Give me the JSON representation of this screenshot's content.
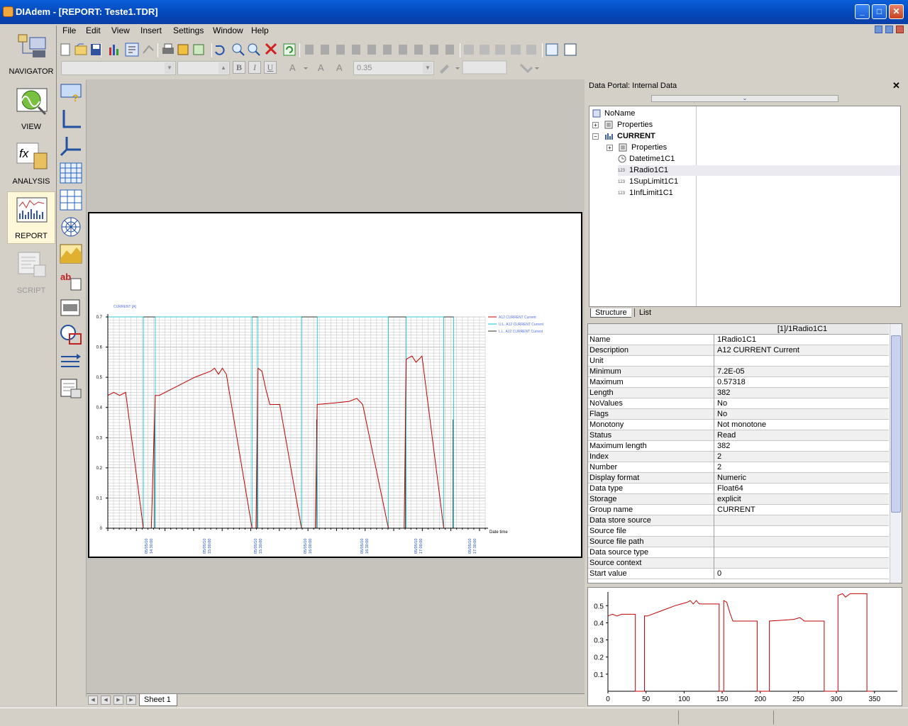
{
  "window": {
    "title": "DIAdem - [REPORT:   Teste1.TDR]",
    "minimize": "_",
    "maximize": "□",
    "close": "✕"
  },
  "menu": [
    "File",
    "Edit",
    "View",
    "Insert",
    "Settings",
    "Window",
    "Help"
  ],
  "format_bar": {
    "line_width": "0.35",
    "bold": "B",
    "italic": "I",
    "underline": "U"
  },
  "nav": {
    "items": [
      {
        "label": "NAVIGATOR",
        "icon": "navigator-icon",
        "state": "normal"
      },
      {
        "label": "VIEW",
        "icon": "view-icon",
        "state": "normal"
      },
      {
        "label": "ANALYSIS",
        "icon": "analysis-icon",
        "state": "normal"
      },
      {
        "label": "REPORT",
        "icon": "report-icon",
        "state": "selected"
      },
      {
        "label": "SCRIPT",
        "icon": "script-icon",
        "state": "disabled"
      }
    ]
  },
  "report": {
    "y_axis_title": "CURRENT [A]",
    "x_axis_title": "Date time",
    "legend": [
      {
        "label": "A12 CURRENT Current",
        "color": "#c00000"
      },
      {
        "label": "U.L. A12 CURRENT Current",
        "color": "#00c8d0"
      },
      {
        "label": "L.L. A12 CURRENT Current",
        "color": "#303030"
      }
    ],
    "y_ticks": [
      "0.7",
      "0.6",
      "0.5",
      "0.4",
      "0.3",
      "0.2",
      "0.1",
      "0"
    ],
    "x_ticks": [
      "05/05/10 14:30:00",
      "05/05/10 15:00:00",
      "05/05/10 15:30:00",
      "05/05/10 16:00:00",
      "05/05/10 16:30:00",
      "05/05/10 17:00:00",
      "05/05/10 17:30:00"
    ]
  },
  "sheet_tabs": [
    "Sheet 1"
  ],
  "portal": {
    "title": "Data Portal: Internal Data",
    "tree": {
      "root": "NoName",
      "root_properties": "Properties",
      "group": "CURRENT",
      "group_properties": "Properties",
      "channels": [
        "Datetime1C1",
        "1Radio1C1",
        "1SupLimit1C1",
        "1InfLimit1C1"
      ],
      "selected": "1Radio1C1"
    },
    "tabs": [
      "Structure",
      "List"
    ],
    "prop_header": "[1]/1Radio1C1",
    "properties": [
      {
        "k": "Name",
        "v": "1Radio1C1"
      },
      {
        "k": "Description",
        "v": "A12 CURRENT Current"
      },
      {
        "k": "Unit",
        "v": ""
      },
      {
        "k": "Minimum",
        "v": "7.2E-05"
      },
      {
        "k": "Maximum",
        "v": "0.57318"
      },
      {
        "k": "Length",
        "v": "382"
      },
      {
        "k": "NoValues",
        "v": "No"
      },
      {
        "k": "Flags",
        "v": "No"
      },
      {
        "k": "Monotony",
        "v": "Not monotone"
      },
      {
        "k": "Status",
        "v": "Read"
      },
      {
        "k": "Maximum length",
        "v": "382"
      },
      {
        "k": "Index",
        "v": "2"
      },
      {
        "k": "Number",
        "v": "2"
      },
      {
        "k": "Display format",
        "v": "Numeric"
      },
      {
        "k": "Data type",
        "v": "Float64"
      },
      {
        "k": "Storage",
        "v": "explicit"
      },
      {
        "k": "Group name",
        "v": "CURRENT"
      },
      {
        "k": "Data store source",
        "v": ""
      },
      {
        "k": "Source file",
        "v": ""
      },
      {
        "k": "Source file path",
        "v": ""
      },
      {
        "k": "Data source type",
        "v": ""
      },
      {
        "k": "Source context",
        "v": ""
      },
      {
        "k": "Start value",
        "v": "0"
      }
    ],
    "preview_y_ticks": [
      "0.5",
      "0.4",
      "0.3",
      "0.2",
      "0.1"
    ],
    "preview_x_ticks": [
      "0",
      "50",
      "100",
      "150",
      "200",
      "250",
      "300",
      "350"
    ]
  },
  "chart_data": {
    "type": "line",
    "xlabel": "Date time",
    "ylabel": "CURRENT [A]",
    "ylim": [
      0,
      0.7
    ],
    "x_range_index": [
      0,
      382
    ],
    "grid": true,
    "legend_position": "top-right",
    "series": [
      {
        "name": "A12 CURRENT Current",
        "color": "#c00000",
        "points": [
          [
            0,
            0.44
          ],
          [
            6,
            0.45
          ],
          [
            12,
            0.44
          ],
          [
            18,
            0.45
          ],
          [
            36,
            0.0
          ],
          [
            44,
            0.0
          ],
          [
            48,
            0.44
          ],
          [
            52,
            0.44
          ],
          [
            70,
            0.47
          ],
          [
            88,
            0.5
          ],
          [
            104,
            0.52
          ],
          [
            108,
            0.53
          ],
          [
            112,
            0.51
          ],
          [
            116,
            0.53
          ],
          [
            120,
            0.51
          ],
          [
            146,
            0.0
          ],
          [
            150,
            0.0
          ],
          [
            152,
            0.53
          ],
          [
            156,
            0.52
          ],
          [
            160,
            0.46
          ],
          [
            164,
            0.41
          ],
          [
            168,
            0.41
          ],
          [
            174,
            0.41
          ],
          [
            196,
            0.0
          ],
          [
            210,
            0.0
          ],
          [
            212,
            0.41
          ],
          [
            230,
            0.415
          ],
          [
            244,
            0.42
          ],
          [
            252,
            0.43
          ],
          [
            258,
            0.41
          ],
          [
            284,
            0.0
          ],
          [
            300,
            0.0
          ],
          [
            302,
            0.56
          ],
          [
            308,
            0.57
          ],
          [
            312,
            0.55
          ],
          [
            318,
            0.57
          ],
          [
            340,
            0.0
          ],
          [
            348,
            0.0
          ]
        ]
      },
      {
        "name": "U.L. A12 CURRENT Current",
        "color": "#00c8d0"
      },
      {
        "name": "L.L. A12 CURRENT Current",
        "color": "#303030"
      }
    ]
  }
}
